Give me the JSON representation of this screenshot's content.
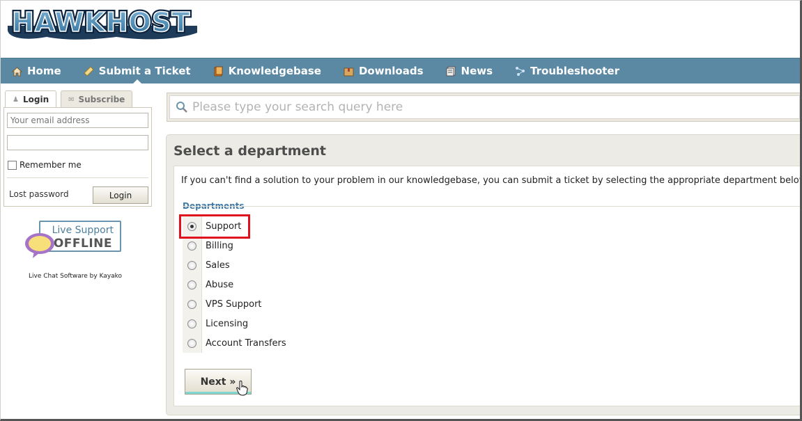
{
  "brand": {
    "logo_text": "HAWKHOST"
  },
  "nav": {
    "items": [
      {
        "label": "Home",
        "icon": "home-icon"
      },
      {
        "label": "Submit a Ticket",
        "icon": "ticket-icon"
      },
      {
        "label": "Knowledgebase",
        "icon": "book-icon"
      },
      {
        "label": "Downloads",
        "icon": "package-icon"
      },
      {
        "label": "News",
        "icon": "news-icon"
      },
      {
        "label": "Troubleshooter",
        "icon": "troubleshooter-icon"
      }
    ],
    "active_index": 1
  },
  "sidebar": {
    "tabs": [
      {
        "label": "Login",
        "icon": "user-icon"
      },
      {
        "label": "Subscribe",
        "icon": "mail-icon"
      }
    ],
    "email_placeholder": "Your email address",
    "password_placeholder": "",
    "remember_label": "Remember me",
    "lost_password_label": "Lost password",
    "login_button_label": "Login"
  },
  "live_support": {
    "line1": "Live Support",
    "line2": "OFFLINE",
    "credit": "Live Chat Software by Kayako"
  },
  "search": {
    "placeholder": "Please type your search query here"
  },
  "main": {
    "title": "Select a department",
    "intro": "If you can't find a solution to your problem in our knowledgebase, you can submit a ticket by selecting the appropriate department below.",
    "departments_heading": "Departments",
    "departments": [
      {
        "label": "Support",
        "selected": true
      },
      {
        "label": "Billing",
        "selected": false
      },
      {
        "label": "Sales",
        "selected": false
      },
      {
        "label": "Abuse",
        "selected": false
      },
      {
        "label": "VPS Support",
        "selected": false
      },
      {
        "label": "Licensing",
        "selected": false
      },
      {
        "label": "Account Transfers",
        "selected": false
      }
    ],
    "next_button_label": "Next »"
  },
  "colors": {
    "nav_bar": "#5b88a3",
    "highlight": "#e0101c",
    "departments_heading": "#3e78a7"
  }
}
